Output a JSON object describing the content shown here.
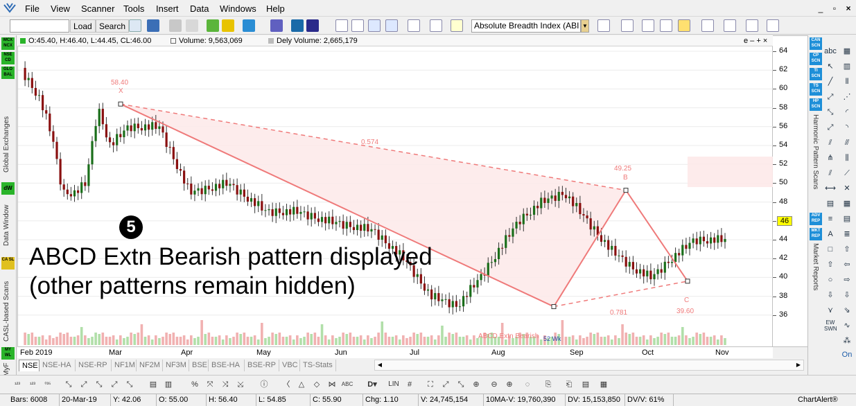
{
  "menubar": {
    "items": [
      "File",
      "View",
      "Scanner",
      "Tools",
      "Insert",
      "Data",
      "Windows",
      "Help"
    ]
  },
  "toolbar": {
    "symbol_value": "",
    "load_label": "Load",
    "search_label": "Search",
    "indicator_value": "Absolute Breadth Index (ABI"
  },
  "info_bar": {
    "ohlc": "O:45.40, H:46.40, L:44.45, CL:46.00",
    "volume": "Volume: 9,563,069",
    "dely_volume": "Dely Volume: 2,665,179",
    "controls": "e – + ×"
  },
  "left_panel": {
    "badges": [
      {
        "label": "MCX NCX",
        "color": "#28b428"
      },
      {
        "label": "NSE CD",
        "color": "#28b428"
      },
      {
        "label": "GLO BAL",
        "color": "#28b428"
      }
    ],
    "global_exchanges": "Global Exchanges",
    "dw_badge": "dW",
    "data_window": "Data Window",
    "casl_badge": "CA SL",
    "casl_scans": "CASL-based Scans",
    "my_badge": "MY WL",
    "my_label": "MyF"
  },
  "right_panel": {
    "badges": [
      "CAN SCN",
      "CP SCN",
      "TI SCN",
      "TS SCN",
      "HP SCN"
    ],
    "harmonic_label": "Harmonic Pattern Scans",
    "report_badges": [
      "ADV REP",
      "MKT REP"
    ],
    "market_reports": "Market Reports"
  },
  "chart": {
    "y_ticks": [
      "64",
      "62",
      "60",
      "58",
      "56",
      "54",
      "52",
      "50",
      "48",
      "46",
      "44",
      "42",
      "40",
      "38",
      "36"
    ],
    "last_price": "46",
    "x_ticks": [
      "Feb 2019",
      "Mar",
      "Apr",
      "May",
      "Jun",
      "Jul",
      "Aug",
      "Sep",
      "Oct",
      "Nov"
    ],
    "pattern": {
      "x_label": "58.40",
      "x_point": "X",
      "a_label": "ABCD Extn Bearish",
      "a_sublabel": "52 Wk",
      "b_label": "49.25",
      "b_point": "B",
      "c_label": "39.60",
      "c_point": "C",
      "ratio_xb": "0.574",
      "ratio_ac": "0.781"
    },
    "candle_colors": {
      "up": "#1a6e1a",
      "down": "#8a1010",
      "pattern_line": "#ef7a7a",
      "fill": "#fde9e9"
    }
  },
  "annotation": {
    "number": "❺",
    "line1": "ABCD Extn Bearish pattern displayed",
    "line2": "(other patterns remain hidden)"
  },
  "tabs": [
    "NSE",
    "NSE-HA",
    "NSE-RP",
    "NF1M",
    "NF2M",
    "NF3M",
    "BSE",
    "BSE-HA",
    "BSE-RP",
    "VBC",
    "TS-Stats"
  ],
  "bottom_toolbar": {
    "lin_label": "LIN",
    "on_label": "On"
  },
  "status": {
    "bars": "Bars: 6008",
    "date": "20-Mar-19",
    "y": "Y: 42.06",
    "o": "O: 55.00",
    "h": "H: 56.40",
    "l": "L: 54.85",
    "c": "C: 55.90",
    "chg": "Chg: 1.10",
    "v": "V: 24,745,154",
    "ma_v": "10MA-V: 19,760,390",
    "dv": "DV: 15,153,850",
    "dv_v": "DV/V: 61%",
    "brand": "ChartAlert®"
  }
}
